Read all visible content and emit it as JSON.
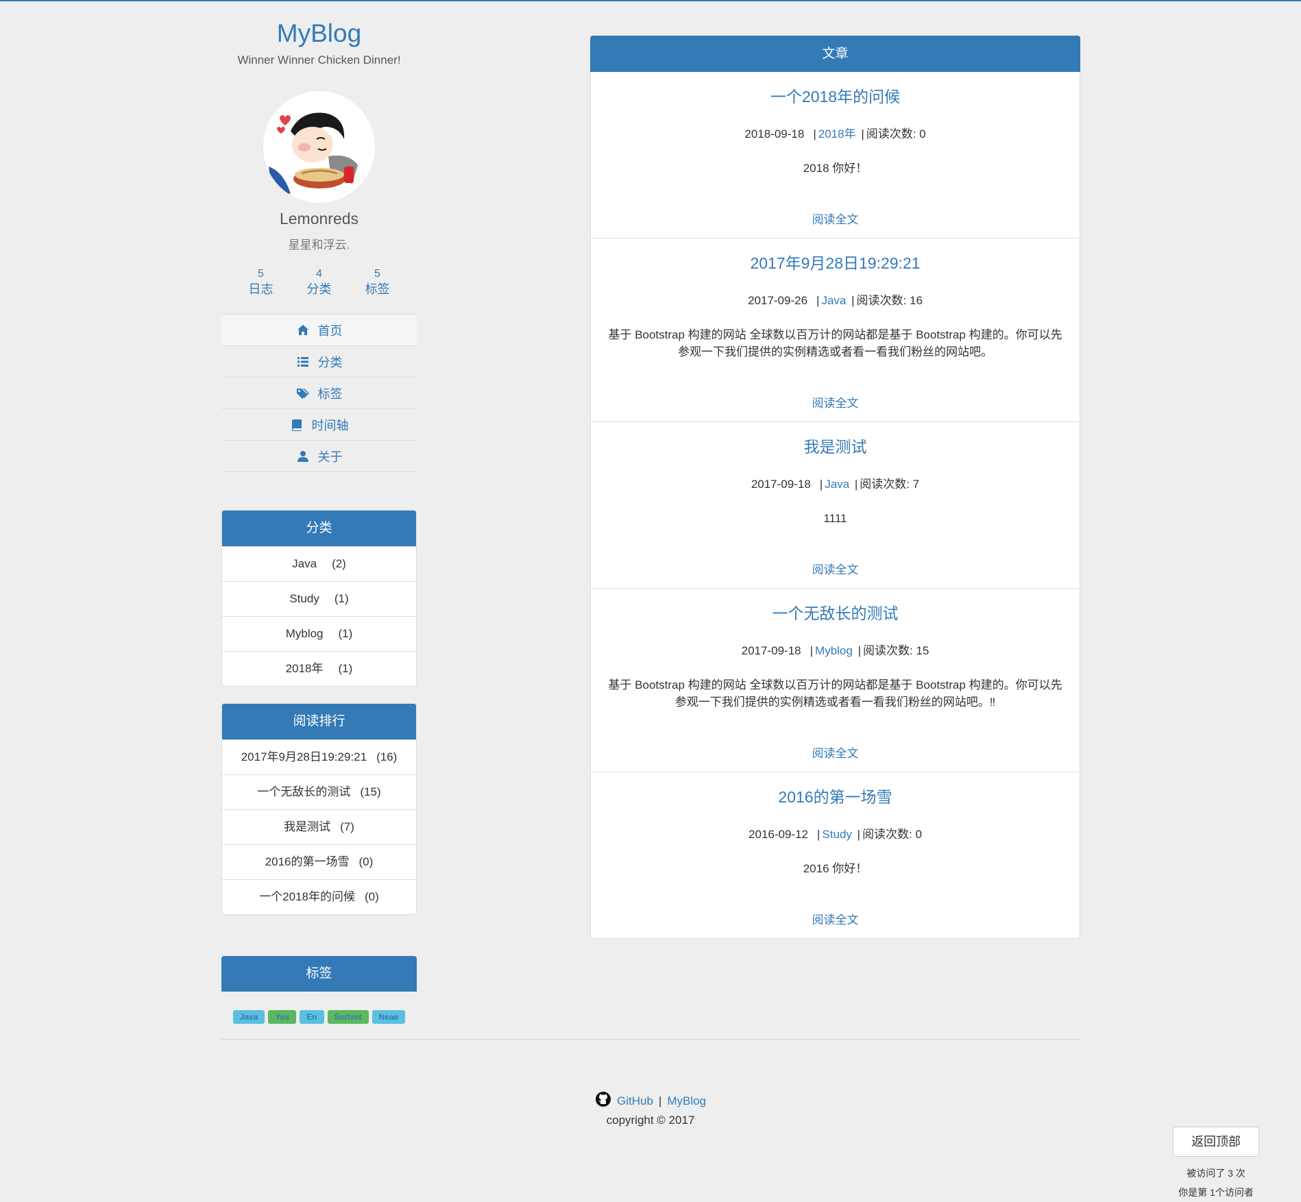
{
  "site": {
    "title": "MyBlog",
    "subtitle": "Winner Winner Chicken Dinner!"
  },
  "author": {
    "name": "Lemonreds",
    "motto": "星星和浮云."
  },
  "stats": [
    {
      "count": "5",
      "label": "日志"
    },
    {
      "count": "4",
      "label": "分类"
    },
    {
      "count": "5",
      "label": "标签"
    }
  ],
  "nav": [
    {
      "label": "首页",
      "icon": "home-icon"
    },
    {
      "label": "分类",
      "icon": "list-icon"
    },
    {
      "label": "标签",
      "icon": "tags-icon"
    },
    {
      "label": "时间轴",
      "icon": "book-icon"
    },
    {
      "label": "关于",
      "icon": "user-icon"
    }
  ],
  "categories": {
    "heading": "分类",
    "items": [
      {
        "name": "Java",
        "count": "(2)"
      },
      {
        "name": "Study",
        "count": "(1)"
      },
      {
        "name": "Myblog",
        "count": "(1)"
      },
      {
        "name": "2018年",
        "count": "(1)"
      }
    ]
  },
  "ranking": {
    "heading": "阅读排行",
    "items": [
      {
        "title": "2017年9月28日19:29:21",
        "count": "(16)"
      },
      {
        "title": "一个无敌长的测试",
        "count": "(15)"
      },
      {
        "title": "我是测试",
        "count": "(7)"
      },
      {
        "title": "2016的第一场雪",
        "count": "(0)"
      },
      {
        "title": "一个2018年的问候",
        "count": "(0)"
      }
    ]
  },
  "tags": {
    "heading": "标签",
    "items": [
      {
        "label": "Java",
        "style": "info"
      },
      {
        "label": "Yes",
        "style": "success"
      },
      {
        "label": "En",
        "style": "info"
      },
      {
        "label": "Serlvet",
        "style": "success"
      },
      {
        "label": "Neae",
        "style": "info"
      }
    ]
  },
  "main": {
    "heading": "文章",
    "read_more": "阅读全文",
    "articles": [
      {
        "title": "一个2018年的问候",
        "date": "2018-09-18",
        "category": "2018年",
        "views": "阅读次数: 0",
        "summary": "2018 你好！"
      },
      {
        "title": "2017年9月28日19:29:21",
        "date": "2017-09-26",
        "category": "Java",
        "views": "阅读次数: 16",
        "summary": "基于 Bootstrap 构建的网站 全球数以百万计的网站都是基于 Bootstrap 构建的。你可以先参观一下我们提供的实例精选或者看一看我们粉丝的网站吧。"
      },
      {
        "title": "我是测试",
        "date": "2017-09-18",
        "category": "Java",
        "views": "阅读次数: 7",
        "summary": "1111"
      },
      {
        "title": "一个无敌长的测试",
        "date": "2017-09-18",
        "category": "Myblog",
        "views": "阅读次数: 15",
        "summary": "基于 Bootstrap 构建的网站 全球数以百万计的网站都是基于 Bootstrap 构建的。你可以先参观一下我们提供的实例精选或者看一看我们粉丝的网站吧。‼"
      },
      {
        "title": "2016的第一场雪",
        "date": "2016-09-12",
        "category": "Study",
        "views": "阅读次数: 0",
        "summary": "2016 你好！"
      }
    ]
  },
  "footer": {
    "github": "GitHub",
    "separator": "|",
    "blog": "MyBlog",
    "copyright": "copyright © 2017"
  },
  "back_to_top": "返回顶部",
  "visits": {
    "total": "被访问了 3 次",
    "visitor": "你是第 1个访问者"
  },
  "colors": {
    "primary": "#337ab7",
    "background": "#eeeeee",
    "tag_info": "#5bc0de",
    "tag_success": "#5cb85c"
  }
}
